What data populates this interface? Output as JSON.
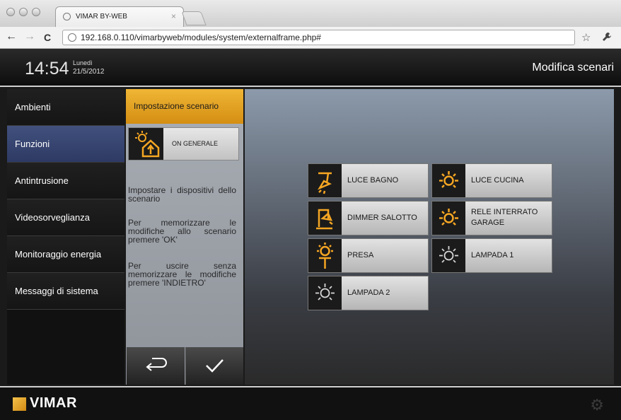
{
  "browser": {
    "tab_title": "VIMAR BY-WEB",
    "tab_close": "×",
    "url": "192.168.0.110/vimarbyweb/modules/system/externalframe.php#",
    "back_icon": "←",
    "forward_icon": "→",
    "reload_icon": "C",
    "star_icon": "☆",
    "wrench_icon": "🔧"
  },
  "header": {
    "time": "14:54",
    "day": "Lunedì",
    "date": "21/5/2012",
    "title": "Modifica scenari"
  },
  "sidebar": {
    "items": [
      {
        "label": "Ambienti",
        "active": false
      },
      {
        "label": "Funzioni",
        "active": true
      },
      {
        "label": "Antintrusione",
        "active": false
      },
      {
        "label": "Videosorveglianza",
        "active": false
      },
      {
        "label": "Monitoraggio energia",
        "active": false
      },
      {
        "label": "Messaggi di sistema",
        "active": false
      }
    ]
  },
  "panel": {
    "header": "Impostazione scenario",
    "scenario_label": "ON GENERALE",
    "instructions": [
      "Impostare i dispositivi dello scenario",
      "Per memorizzare le modifiche allo scenario premere 'OK'",
      "Per uscire senza memorizzare le modifiche premere 'INDIETRO'"
    ],
    "back_icon": "↩",
    "ok_icon": "✓"
  },
  "devices": [
    {
      "label": "LUCE BAGNO",
      "icon": "wall-lamp-icon",
      "active": true
    },
    {
      "label": "LUCE CUCINA",
      "icon": "bulb-icon",
      "active": true
    },
    {
      "label": "DIMMER SALOTTO",
      "icon": "dimmer-icon",
      "active": true
    },
    {
      "label": "RELE INTERRATO GARAGE",
      "icon": "bulb-icon",
      "active": true
    },
    {
      "label": "PRESA",
      "icon": "ceiling-lamp-icon",
      "active": true
    },
    {
      "label": "LAMPADA 1",
      "icon": "bulb-icon",
      "active": false
    },
    {
      "label": "LAMPADA 2",
      "icon": "bulb-icon",
      "active": false
    }
  ],
  "footer": {
    "brand": "VIMAR",
    "settings_icon": "⚙"
  },
  "colors": {
    "accent": "#f0a31c",
    "active_icon": "#f5a623",
    "inactive_icon": "#d6d6d6",
    "nav_active": "#3a4672"
  }
}
